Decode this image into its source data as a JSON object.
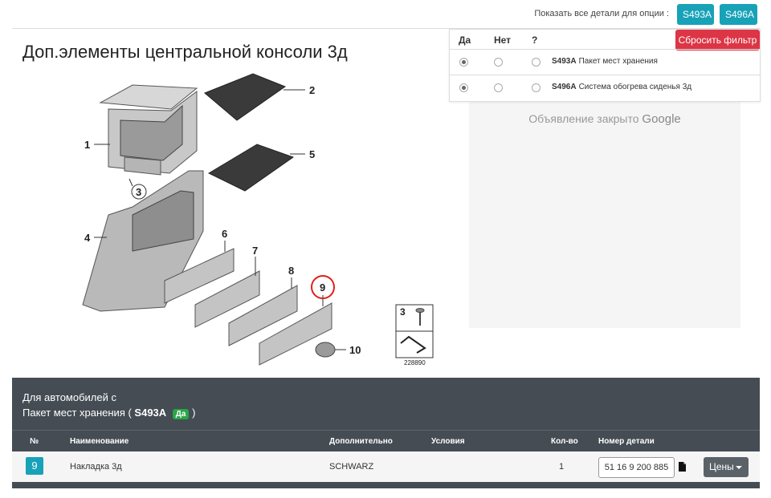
{
  "topbar": {
    "show_label": "Показать все детали для опции :",
    "options": [
      "S493A",
      "S496A"
    ]
  },
  "page_title": "Доп.элементы центральной консоли 3д",
  "filter": {
    "headers": {
      "yes": "Да",
      "no": "Нет",
      "unknown": "?"
    },
    "reset_label": "Сбросить фильтр",
    "rows": [
      {
        "code": "S493A",
        "label": "Пакет мест хранения",
        "selected": "yes"
      },
      {
        "code": "S496A",
        "label": "Система обогрева сиденья 3д",
        "selected": "yes"
      }
    ]
  },
  "ad": {
    "text": "Объявление закрыто",
    "brand": "Google"
  },
  "diagram": {
    "callouts": [
      "1",
      "2",
      "3",
      "4",
      "5",
      "6",
      "7",
      "8",
      "9",
      "10"
    ],
    "inset_callout": "3",
    "inset_ref": "228890",
    "highlight_color": "#e0201a"
  },
  "panel": {
    "line1": "Для автомобилей с",
    "line2_prefix": "Пакет мест хранения (",
    "line2_code": "S493A",
    "line2_badge": "Да",
    "line2_suffix": ")",
    "columns": {
      "num": "№",
      "name": "Наименование",
      "extra": "Дополнительно",
      "conditions": "Условия",
      "qty": "Кол-во",
      "partno": "Номер детали"
    },
    "rows": [
      {
        "num": "9",
        "name": "Накладка 3д",
        "extra": "SCHWARZ",
        "conditions": "",
        "qty": "1",
        "partno": "51 16 9 200 885",
        "price_label": "Цены"
      }
    ]
  },
  "colors": {
    "accent": "#17a2b8",
    "danger": "#dc3545",
    "success": "#28a745",
    "panel": "#454c54"
  }
}
